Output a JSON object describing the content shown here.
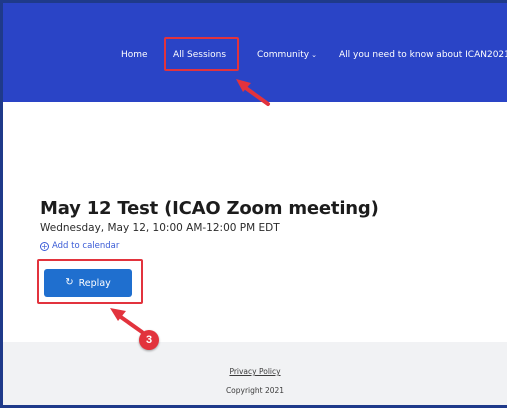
{
  "nav": {
    "home": "Home",
    "all_sessions": "All Sessions",
    "community": "Community",
    "about": "All you need to know about ICAN2021"
  },
  "event": {
    "title": "May 12 Test (ICAO Zoom meeting)",
    "datetime": "Wednesday, May 12, 10:00 AM-12:00 PM EDT",
    "add_to_calendar": "Add to calendar",
    "replay_label": "Replay"
  },
  "footer": {
    "privacy": "Privacy Policy",
    "copyright": "Copyright 2021"
  },
  "annotation": {
    "step_number": "3"
  },
  "icons": {
    "chevron": "chevron-down-icon",
    "plus_circle": "plus-circle-icon",
    "replay": "replay-icon"
  },
  "colors": {
    "navbar": "#2a44c6",
    "highlight": "#e2333d",
    "button": "#1f6fcf",
    "link": "#3a5bd6",
    "footer": "#f1f2f4"
  }
}
